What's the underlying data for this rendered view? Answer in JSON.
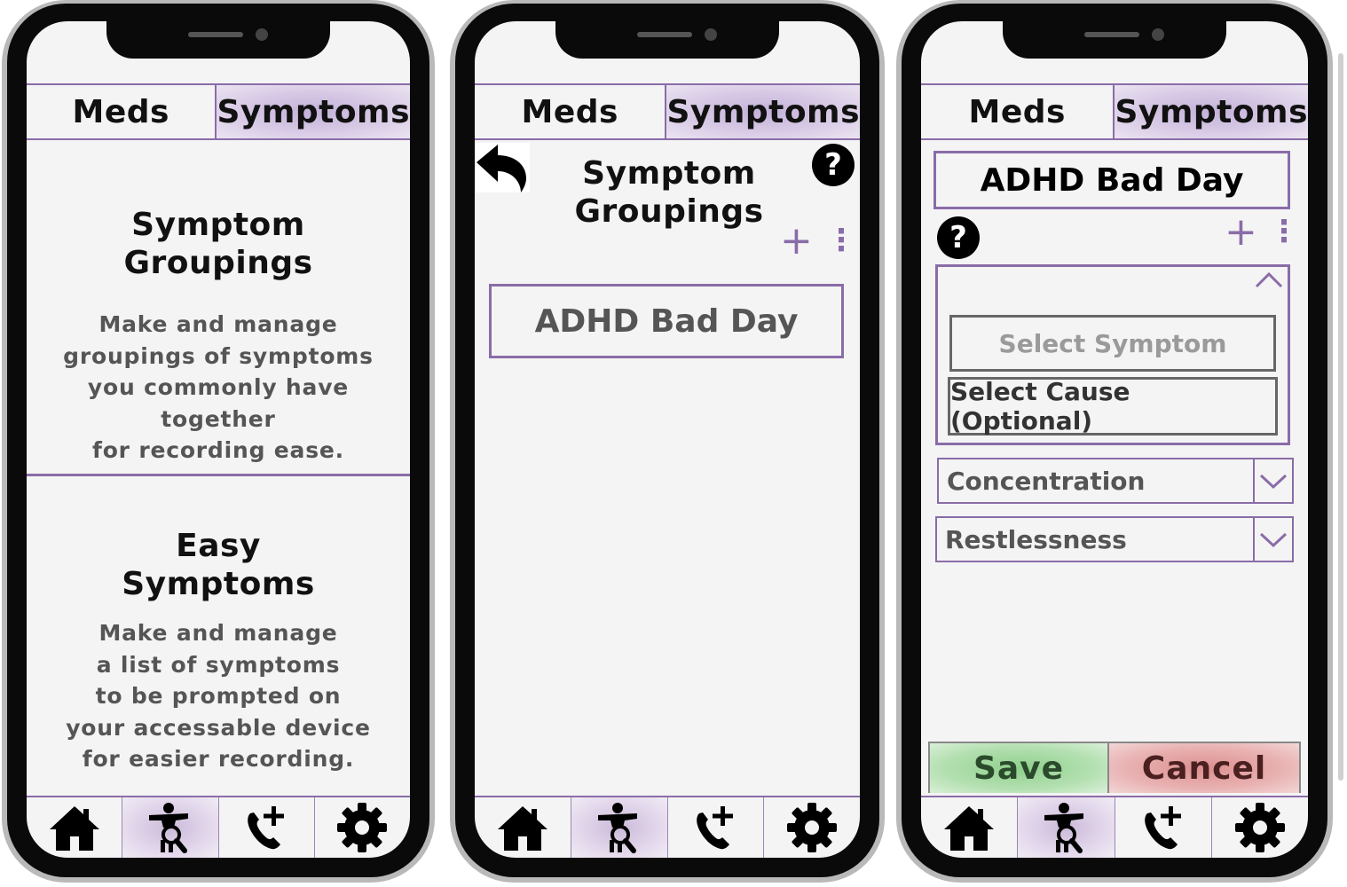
{
  "tabs": {
    "meds": "Meds",
    "symptoms": "Symptoms"
  },
  "nav": {
    "items": [
      {
        "icon": "home-icon"
      },
      {
        "icon": "symptom-search-icon",
        "active": true
      },
      {
        "icon": "phone-add-icon"
      },
      {
        "icon": "gear-icon"
      }
    ]
  },
  "screen1": {
    "groupings": {
      "title_line1": "Symptom",
      "title_line2": "Groupings",
      "desc": [
        "Make and manage",
        "groupings of symptoms",
        "you commonly have together",
        "for recording ease."
      ]
    },
    "easy": {
      "title_line1": "Easy",
      "title_line2": "Symptoms",
      "desc": [
        "Make and manage",
        "a list of symptoms",
        "to be prompted on",
        "your accessable device",
        "for easier recording."
      ]
    }
  },
  "screen2": {
    "title_line1": "Symptom",
    "title_line2": "Groupings",
    "help": "?",
    "add": "+",
    "more": "⋮",
    "groupings": [
      "ADHD Bad Day"
    ]
  },
  "screen3": {
    "group_name": "ADHD Bad Day",
    "help": "?",
    "add": "+",
    "more": "⋮",
    "select_symptom_placeholder": "Select Symptom",
    "select_cause": "Select Cause (Optional)",
    "symptoms": [
      "Concentration",
      "Restlessness"
    ],
    "save": "Save",
    "cancel": "Cancel"
  },
  "colors": {
    "accent": "#8a6ca8",
    "active_tab": "#d9cbe6",
    "save": "#9fd79a",
    "cancel": "#e39f9f"
  }
}
